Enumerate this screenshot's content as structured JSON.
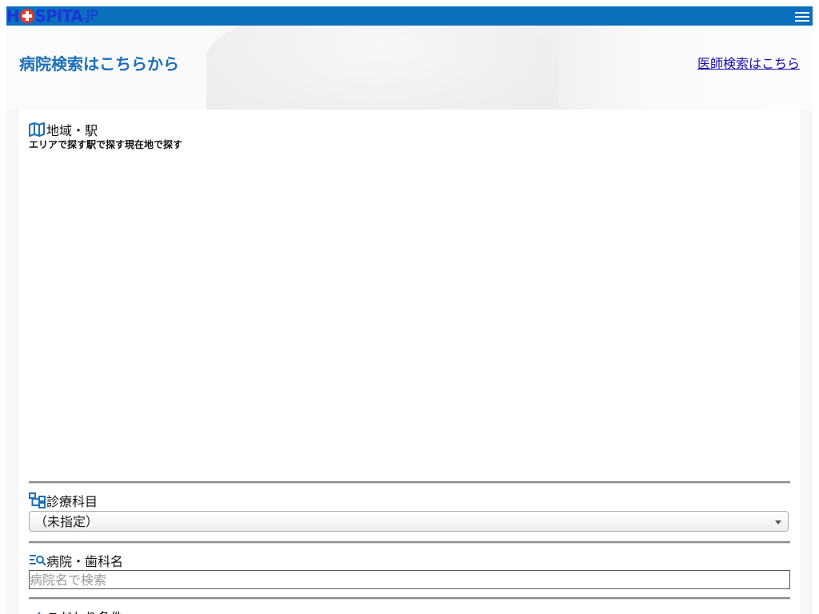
{
  "header": {
    "logo_h": "H",
    "logo_rest": "SPITA",
    "logo_jp": ".JP"
  },
  "hero": {
    "title": "病院検索はこちらから",
    "doctor_link": "医師検索はこちら"
  },
  "area": {
    "title": "地域・駅",
    "tabs": [
      "エリアで探す",
      "駅で探す",
      "現在地で探す"
    ]
  },
  "department": {
    "title": "診療科目",
    "selected": "（未指定）"
  },
  "hospital_name": {
    "title": "病院・歯科名",
    "placeholder": "病院名で検索"
  },
  "conditions": {
    "title": "こだわり条件"
  },
  "colors": {
    "header_bg": "#0a6fbd",
    "accent_blue": "#1d6fb8",
    "link": "#1a0dab",
    "logo_red": "#e83828"
  }
}
